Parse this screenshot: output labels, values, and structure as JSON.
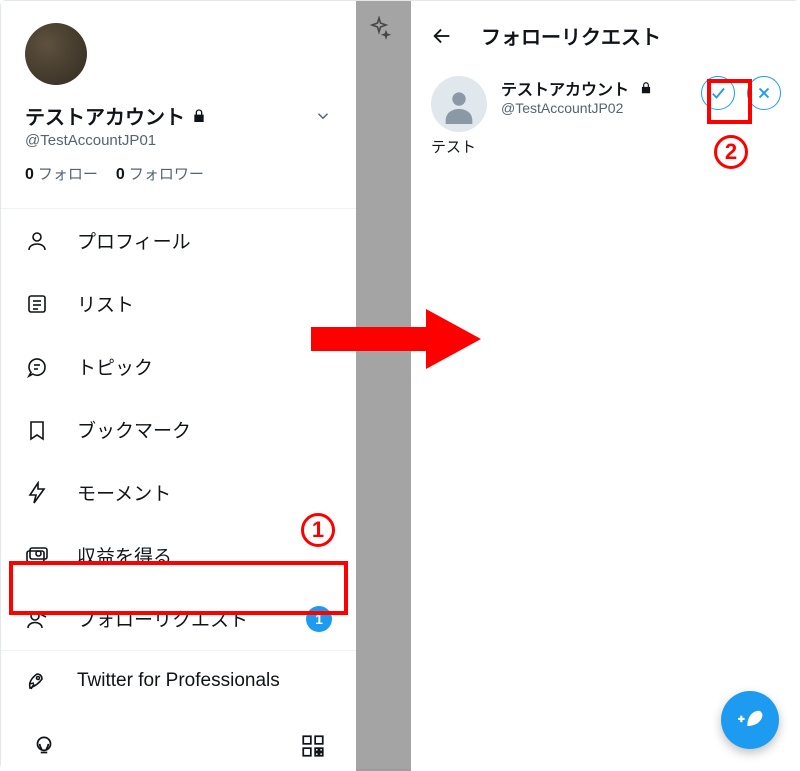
{
  "left": {
    "profile": {
      "name": "テストアカウント",
      "handle": "@TestAccountJP01",
      "following_count": "0",
      "following_label": "フォロー",
      "followers_count": "0",
      "followers_label": "フォロワー"
    },
    "menu": {
      "profile": "プロフィール",
      "lists": "リスト",
      "topics": "トピック",
      "bookmarks": "ブックマーク",
      "moments": "モーメント",
      "monetization": "収益を得る",
      "follow_requests": "フォローリクエスト",
      "follow_requests_badge": "1",
      "twitter_pro": "Twitter for Professionals"
    }
  },
  "right": {
    "title": "フォローリクエスト",
    "request": {
      "name": "テストアカウント",
      "handle": "@TestAccountJP02",
      "bio": "テスト"
    }
  },
  "annotation": {
    "marker_1": "1",
    "marker_2": "2"
  }
}
